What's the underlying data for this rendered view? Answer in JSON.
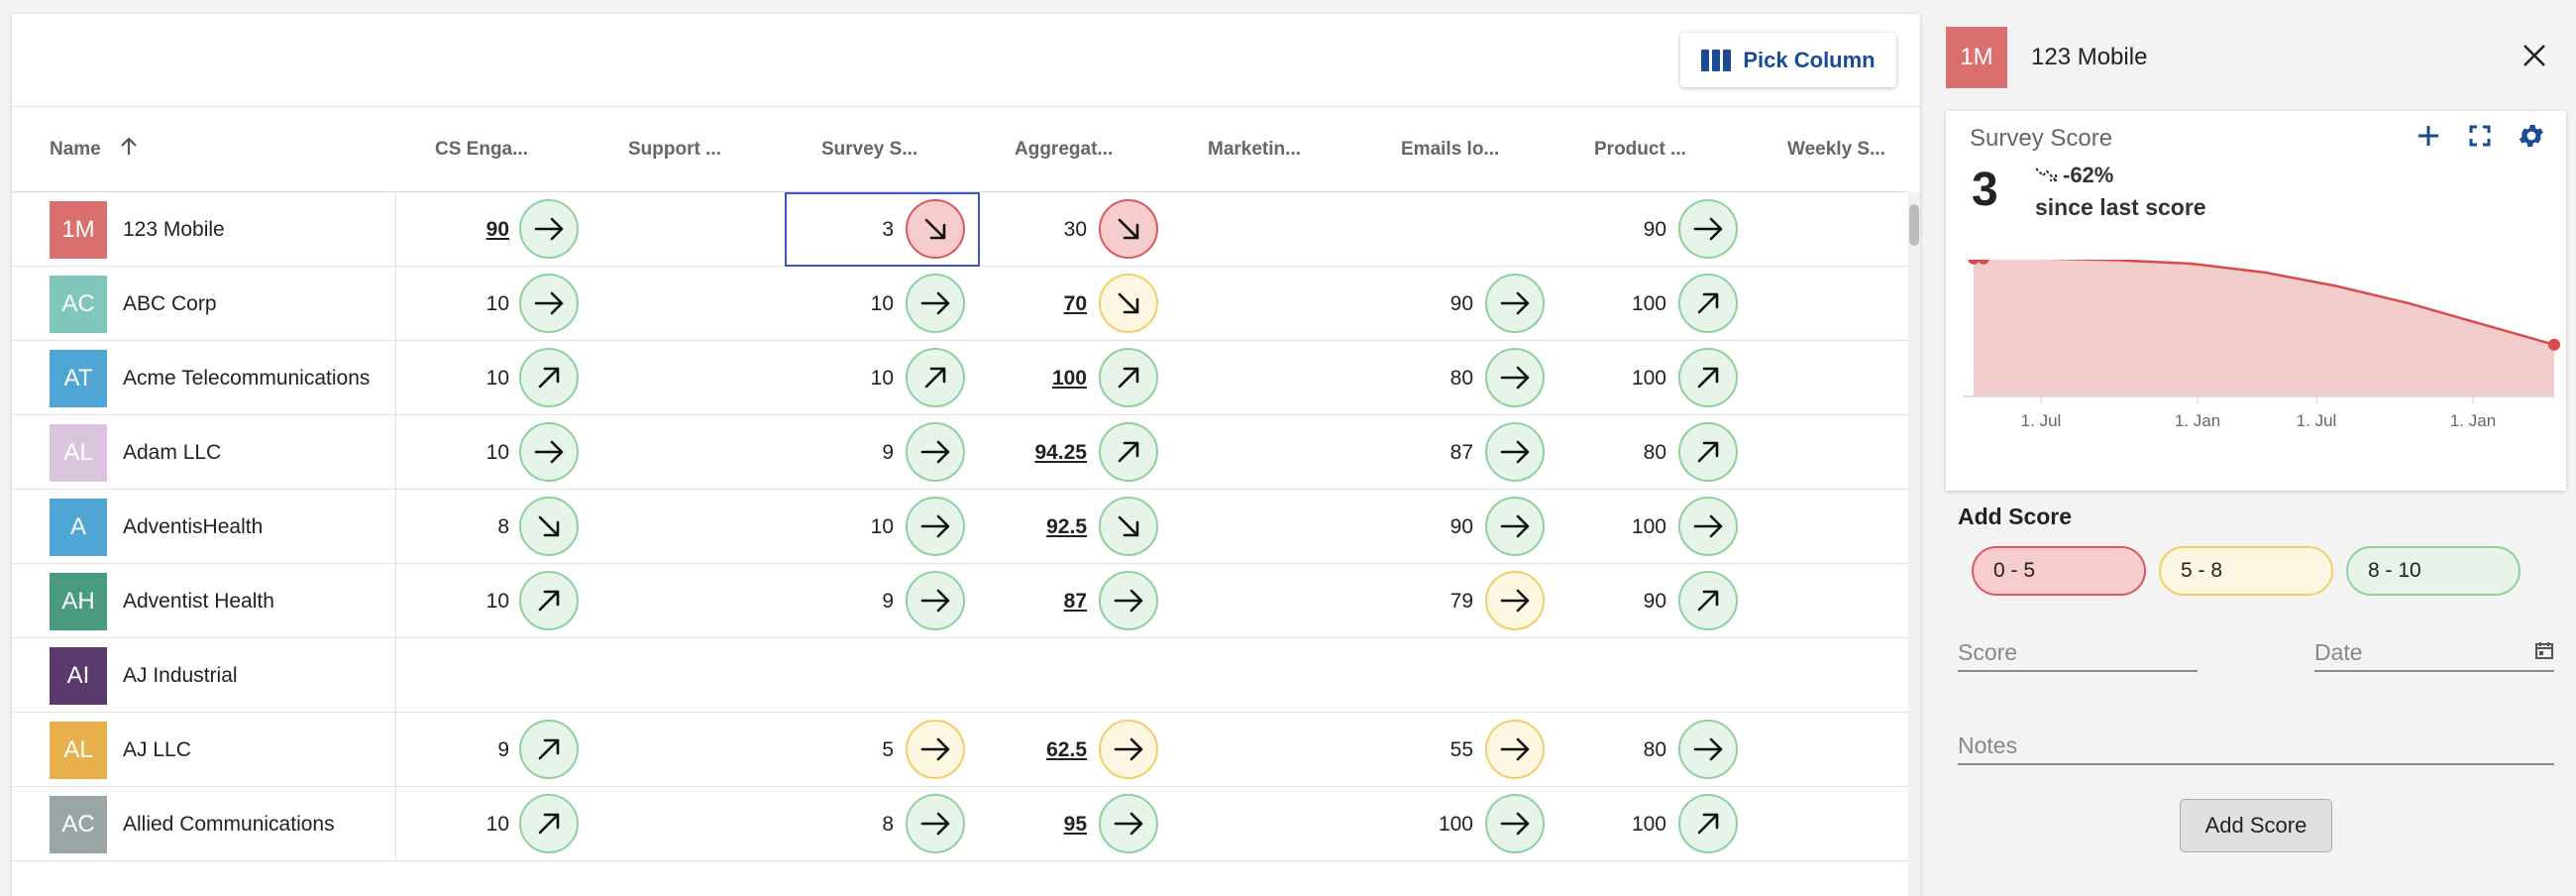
{
  "toolbar": {
    "pick_column_label": "Pick Column"
  },
  "columns": [
    "Name",
    "CS Enga...",
    "Support ...",
    "Survey S...",
    "Aggregat...",
    "Marketin...",
    "Emails lo...",
    "Product ...",
    "Weekly S..."
  ],
  "rows": [
    {
      "initials": "1M",
      "color": "#d9706f",
      "name": "123 Mobile",
      "cs": {
        "v": "90",
        "link": true,
        "t": "right",
        "c": "green"
      },
      "survey": {
        "v": "3",
        "link": false,
        "t": "down",
        "c": "red"
      },
      "agg": {
        "v": "30",
        "link": false,
        "t": "down",
        "c": "red"
      },
      "emails": null,
      "product": {
        "v": "90",
        "link": false,
        "t": "right",
        "c": "green"
      }
    },
    {
      "initials": "AC",
      "color": "#7fc6bd",
      "name": "ABC Corp",
      "cs": {
        "v": "10",
        "link": false,
        "t": "right",
        "c": "green"
      },
      "survey": {
        "v": "10",
        "link": false,
        "t": "right",
        "c": "green"
      },
      "agg": {
        "v": "70",
        "link": true,
        "t": "down",
        "c": "yellow"
      },
      "emails": {
        "v": "90",
        "link": false,
        "t": "right",
        "c": "green"
      },
      "product": {
        "v": "100",
        "link": false,
        "t": "up",
        "c": "green"
      }
    },
    {
      "initials": "AT",
      "color": "#4ea5d6",
      "name": "Acme Telecommunications",
      "cs": {
        "v": "10",
        "link": false,
        "t": "up",
        "c": "green"
      },
      "survey": {
        "v": "10",
        "link": false,
        "t": "up",
        "c": "green"
      },
      "agg": {
        "v": "100",
        "link": true,
        "t": "up",
        "c": "green"
      },
      "emails": {
        "v": "80",
        "link": false,
        "t": "right",
        "c": "green"
      },
      "product": {
        "v": "100",
        "link": false,
        "t": "up",
        "c": "green"
      }
    },
    {
      "initials": "AL",
      "color": "#d9c3dd",
      "name": "Adam LLC",
      "cs": {
        "v": "10",
        "link": false,
        "t": "right",
        "c": "green"
      },
      "survey": {
        "v": "9",
        "link": false,
        "t": "right",
        "c": "green"
      },
      "agg": {
        "v": "94.25",
        "link": true,
        "t": "up",
        "c": "green"
      },
      "emails": {
        "v": "87",
        "link": false,
        "t": "right",
        "c": "green"
      },
      "product": {
        "v": "80",
        "link": false,
        "t": "up",
        "c": "green"
      }
    },
    {
      "initials": "A",
      "color": "#4ea5d6",
      "name": "AdventisHealth",
      "cs": {
        "v": "8",
        "link": false,
        "t": "down",
        "c": "green"
      },
      "survey": {
        "v": "10",
        "link": false,
        "t": "right",
        "c": "green"
      },
      "agg": {
        "v": "92.5",
        "link": true,
        "t": "down",
        "c": "green"
      },
      "emails": {
        "v": "90",
        "link": false,
        "t": "right",
        "c": "green"
      },
      "product": {
        "v": "100",
        "link": false,
        "t": "right",
        "c": "green"
      }
    },
    {
      "initials": "AH",
      "color": "#4a9a7d",
      "name": "Adventist Health",
      "cs": {
        "v": "10",
        "link": false,
        "t": "up",
        "c": "green"
      },
      "survey": {
        "v": "9",
        "link": false,
        "t": "right",
        "c": "green"
      },
      "agg": {
        "v": "87",
        "link": true,
        "t": "right",
        "c": "green"
      },
      "emails": {
        "v": "79",
        "link": false,
        "t": "right",
        "c": "yellow"
      },
      "product": {
        "v": "90",
        "link": false,
        "t": "up",
        "c": "green"
      }
    },
    {
      "initials": "AI",
      "color": "#5b3a6e",
      "name": "AJ Industrial",
      "cs": null,
      "survey": null,
      "agg": null,
      "emails": null,
      "product": null
    },
    {
      "initials": "AL",
      "color": "#e8b04a",
      "name": "AJ LLC",
      "cs": {
        "v": "9",
        "link": false,
        "t": "up",
        "c": "green"
      },
      "survey": {
        "v": "5",
        "link": false,
        "t": "right",
        "c": "yellow"
      },
      "agg": {
        "v": "62.5",
        "link": true,
        "t": "right",
        "c": "yellow"
      },
      "emails": {
        "v": "55",
        "link": false,
        "t": "right",
        "c": "yellow"
      },
      "product": {
        "v": "80",
        "link": false,
        "t": "right",
        "c": "green"
      }
    },
    {
      "initials": "AC",
      "color": "#9aa5a5",
      "name": "Allied Communications",
      "cs": {
        "v": "10",
        "link": false,
        "t": "up",
        "c": "green"
      },
      "survey": {
        "v": "8",
        "link": false,
        "t": "right",
        "c": "green"
      },
      "agg": {
        "v": "95",
        "link": true,
        "t": "right",
        "c": "green"
      },
      "emails": {
        "v": "100",
        "link": false,
        "t": "right",
        "c": "green"
      },
      "product": {
        "v": "100",
        "link": false,
        "t": "up",
        "c": "green"
      }
    }
  ],
  "side": {
    "initials": "1M",
    "avatar_color": "#d9706f",
    "name": "123 Mobile",
    "card_title": "Survey Score",
    "score": "3",
    "delta": "-62%",
    "since": "since last score",
    "add_title": "Add Score",
    "chips": [
      "0 - 5",
      "5 - 8",
      "8 - 10"
    ],
    "score_placeholder": "Score",
    "date_placeholder": "Date",
    "notes_placeholder": "Notes",
    "add_button": "Add Score"
  },
  "chart_data": {
    "type": "area",
    "x_ticks": [
      "1. Jul",
      "1. Jan",
      "1. Jul",
      "1. Jan"
    ],
    "series": [
      {
        "values": [
          8.0,
          8.0,
          7.9,
          7.7,
          7.2,
          6.4,
          5.4,
          4.2,
          3.0
        ]
      }
    ],
    "ylim": [
      0,
      10
    ],
    "color": "#d94a4a"
  }
}
